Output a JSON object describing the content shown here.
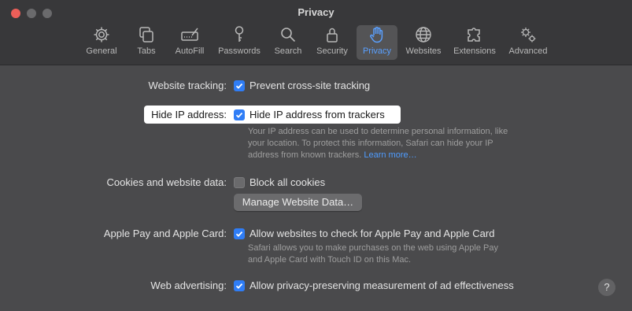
{
  "window": {
    "title": "Privacy"
  },
  "toolbar": {
    "tabs": [
      {
        "label": "General",
        "icon": "gear-icon"
      },
      {
        "label": "Tabs",
        "icon": "tabs-icon"
      },
      {
        "label": "AutoFill",
        "icon": "autofill-icon"
      },
      {
        "label": "Passwords",
        "icon": "key-icon"
      },
      {
        "label": "Search",
        "icon": "magnifier-icon"
      },
      {
        "label": "Security",
        "icon": "lock-icon"
      },
      {
        "label": "Privacy",
        "icon": "hand-icon",
        "selected": true
      },
      {
        "label": "Websites",
        "icon": "globe-icon"
      },
      {
        "label": "Extensions",
        "icon": "puzzle-icon"
      },
      {
        "label": "Advanced",
        "icon": "gears-icon"
      }
    ]
  },
  "settings": {
    "website_tracking": {
      "label": "Website tracking:",
      "option": "Prevent cross-site tracking",
      "checked": true
    },
    "hide_ip": {
      "label": "Hide IP address:",
      "option": "Hide IP address from trackers",
      "checked": true,
      "desc_line1": "Your IP address can be used to determine personal information, like",
      "desc_line2": "your location. To protect this information, Safari can hide your IP",
      "desc_line3": "address from known trackers.",
      "link": "Learn more…"
    },
    "cookies": {
      "label": "Cookies and website data:",
      "option": "Block all cookies",
      "checked": false,
      "button": "Manage Website Data…"
    },
    "apple_pay": {
      "label": "Apple Pay and Apple Card:",
      "option": "Allow websites to check for Apple Pay and Apple Card",
      "checked": true,
      "desc_line1": "Safari allows you to make purchases on the web using Apple Pay",
      "desc_line2": "and Apple Card with Touch ID on this Mac."
    },
    "advertising": {
      "label": "Web advertising:",
      "option": "Allow privacy-preserving measurement of ad effectiveness",
      "checked": true
    }
  },
  "help": {
    "label": "?"
  },
  "colors": {
    "accent": "#2f7df6",
    "selected_tab": "#5aa0ff",
    "link": "#4f9cff"
  }
}
